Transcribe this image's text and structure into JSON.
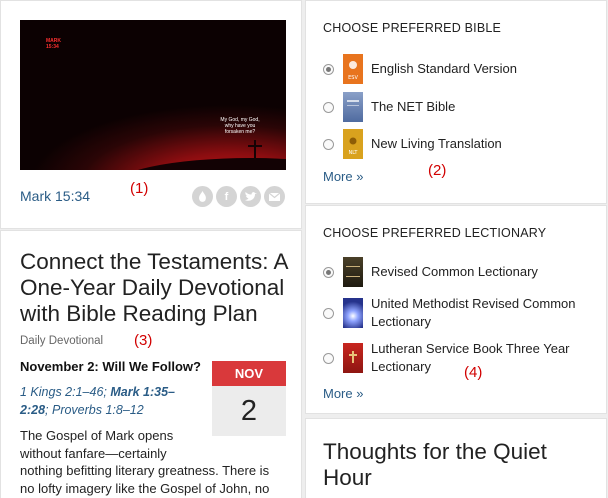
{
  "verse_card": {
    "image_ref_tag": "MARK\n15:34",
    "image_caption": "My God, my God, why have you forsaken me?",
    "reference_link": "Mark 15:34",
    "marker": "(1)",
    "share_icons": [
      "logos-icon",
      "facebook-icon",
      "twitter-icon",
      "email-icon"
    ]
  },
  "devotional": {
    "title": "Connect the Testaments: A One-Year Daily Devotional with Bible Reading Plan",
    "category": "Daily Devotional",
    "marker": "(3)",
    "entry_title": "November 2: Will We Follow?",
    "passages": {
      "p1": "1 Kings 2:1–46",
      "sep1": "; ",
      "p2": "Mark 1:35–2:28",
      "sep2": "; ",
      "p3": "Proverbs 1:8–12"
    },
    "date_month": "NOV",
    "date_day": "2",
    "body_line1": "The Gospel of Mark opens without fanfare—certainly",
    "body_rest": "nothing befitting literary greatness. There is no lofty imagery like the Gospel of John, no"
  },
  "bible_section": {
    "title": "CHOOSE PREFERRED BIBLE",
    "options": [
      {
        "label": "English Standard Version",
        "checked": true,
        "thumb_color": "#e8741e",
        "thumb_text": "ESV"
      },
      {
        "label": "The NET Bible",
        "checked": false,
        "thumb_color": "#6f86b6",
        "thumb_text": "NET"
      },
      {
        "label": "New Living Translation",
        "checked": false,
        "thumb_color": "#d9a21e",
        "thumb_text": "NLT"
      }
    ],
    "more": "More »",
    "marker": "(2)"
  },
  "lectionary_section": {
    "title": "CHOOSE PREFERRED LECTIONARY",
    "options": [
      {
        "label": "Revised Common Lectionary",
        "checked": true,
        "thumb_color": "#3a3320"
      },
      {
        "label": "United Methodist Revised Common Lectionary",
        "checked": false,
        "thumb_color": "#2a3a8a"
      },
      {
        "label": "Lutheran Service Book Three Year Lectionary",
        "checked": false,
        "thumb_color": "#b3221c"
      }
    ],
    "more": "More »",
    "marker": "(4)"
  },
  "quiet_hour": {
    "title": "Thoughts for the Quiet Hour"
  }
}
